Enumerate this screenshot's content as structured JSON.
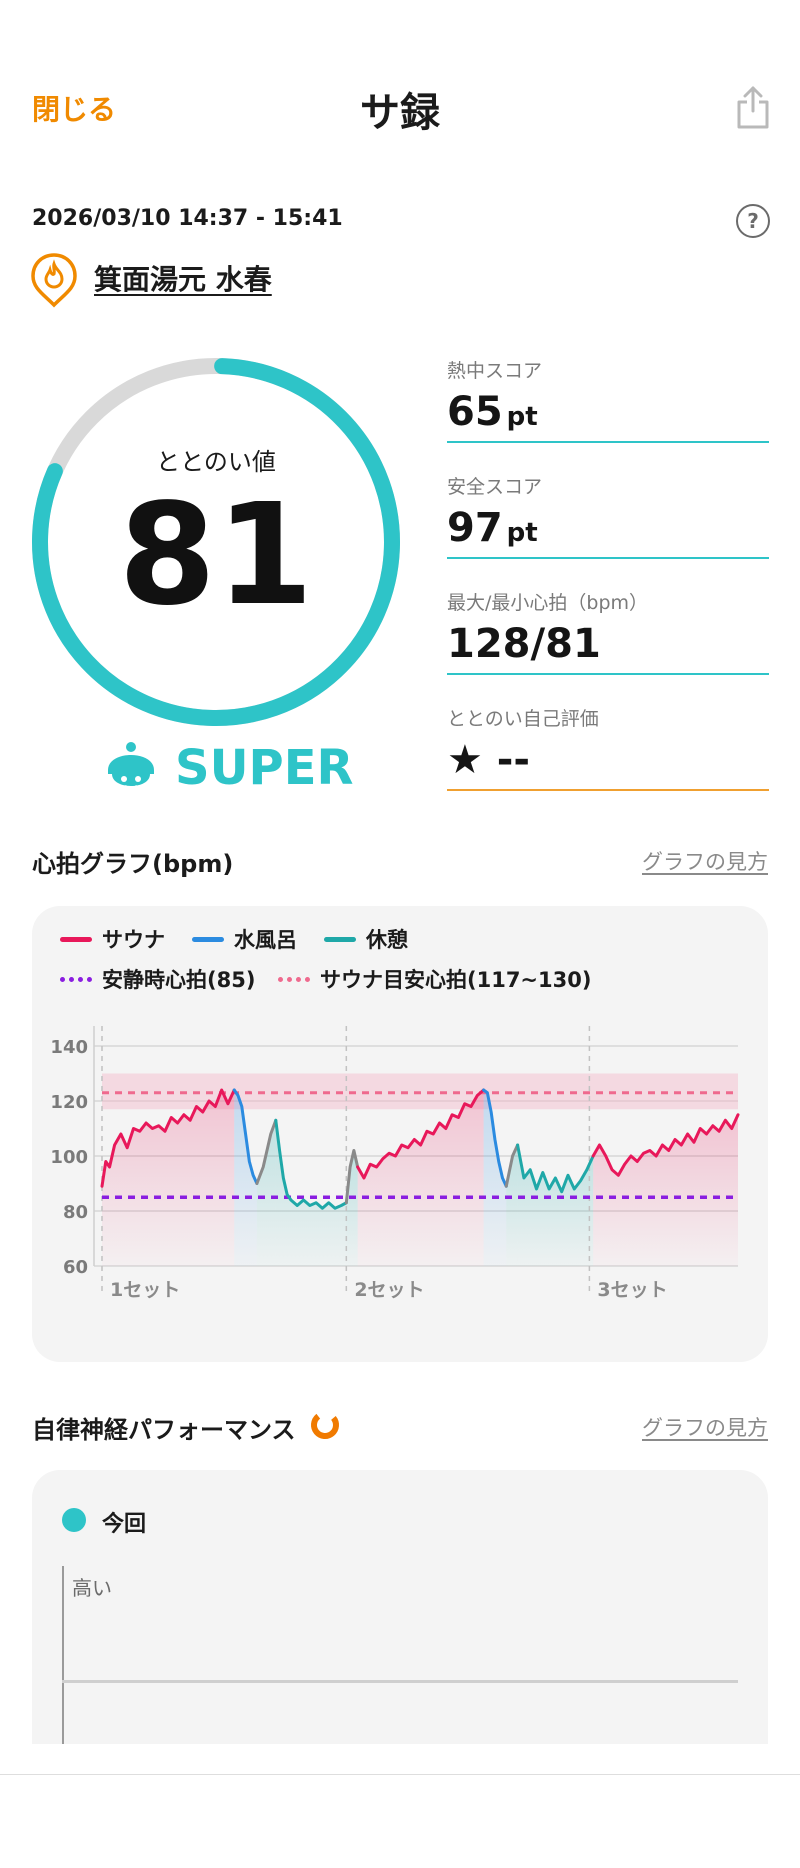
{
  "header": {
    "close_label": "閉じる",
    "title": "サ録"
  },
  "session": {
    "time_range": "2026/03/10 14:37 - 15:41",
    "place_name": "箕面湯元 水春"
  },
  "totonoi": {
    "label": "ととのい値",
    "value": "81",
    "progress": 0.81,
    "rank": "SUPER"
  },
  "stats": [
    {
      "label": "熱中スコア",
      "value": "65",
      "unit": "pt"
    },
    {
      "label": "安全スコア",
      "value": "97",
      "unit": "pt"
    },
    {
      "label": "最大/最小心拍（bpm）",
      "value": "128/81",
      "unit": ""
    },
    {
      "label": "ととのい自己評価",
      "value": "★ --",
      "unit": ""
    }
  ],
  "heart_graph": {
    "title": "心拍グラフ(bpm)",
    "link": "グラフの見方",
    "legend": {
      "sauna": "サウナ",
      "cold": "水風呂",
      "rest": "休憩",
      "resting_hr": "安静時心拍(85)",
      "sauna_target": "サウナ目安心拍(117~130)"
    }
  },
  "chart_data": {
    "type": "line",
    "ylim": [
      60,
      140
    ],
    "yticks": [
      "140",
      "120",
      "100",
      "80",
      "60"
    ],
    "set_labels": [
      "1セット",
      "2セット",
      "3セット"
    ],
    "reference_lines": {
      "resting": 85,
      "target_band": [
        117,
        130
      ],
      "target_line": 123
    },
    "colors": {
      "sauna": "#e8185a",
      "cold": "#2b8be0",
      "rest": "#1fa8a8",
      "transition": "#8a8a8a",
      "resting": "#8a1ee0",
      "target": "#ef6a8e"
    },
    "segments": [
      {
        "type": "sauna",
        "points": [
          [
            0,
            89
          ],
          [
            0.3,
            98
          ],
          [
            0.6,
            96
          ],
          [
            1,
            104
          ],
          [
            1.5,
            108
          ],
          [
            2,
            103
          ],
          [
            2.5,
            110
          ],
          [
            3,
            109
          ],
          [
            3.5,
            112
          ],
          [
            4,
            110
          ],
          [
            4.5,
            111
          ],
          [
            5,
            109
          ],
          [
            5.5,
            114
          ],
          [
            6,
            112
          ],
          [
            6.5,
            115
          ],
          [
            7,
            113
          ],
          [
            7.5,
            118
          ],
          [
            8,
            116
          ],
          [
            8.5,
            120
          ],
          [
            9,
            118
          ],
          [
            9.5,
            124
          ],
          [
            10,
            119
          ],
          [
            10.5,
            124
          ]
        ]
      },
      {
        "type": "cold",
        "points": [
          [
            10.5,
            124
          ],
          [
            10.8,
            122
          ],
          [
            11.1,
            118
          ],
          [
            11.4,
            108
          ],
          [
            11.7,
            98
          ],
          [
            12,
            93
          ],
          [
            12.3,
            90
          ]
        ]
      },
      {
        "type": "transition",
        "points": [
          [
            12.3,
            90
          ],
          [
            12.8,
            96
          ],
          [
            13.4,
            108
          ],
          [
            13.8,
            113
          ]
        ]
      },
      {
        "type": "rest",
        "points": [
          [
            13.8,
            113
          ],
          [
            14.1,
            102
          ],
          [
            14.4,
            92
          ],
          [
            14.7,
            86
          ],
          [
            15,
            84
          ],
          [
            15.5,
            82
          ],
          [
            16,
            84
          ],
          [
            16.5,
            82
          ],
          [
            17,
            83
          ],
          [
            17.5,
            81
          ],
          [
            18,
            83
          ],
          [
            18.5,
            81
          ],
          [
            19,
            82
          ],
          [
            19.4,
            83
          ]
        ]
      },
      {
        "type": "transition",
        "points": [
          [
            19.4,
            83
          ],
          [
            19.7,
            96
          ],
          [
            20,
            102
          ],
          [
            20.3,
            96
          ]
        ]
      },
      {
        "type": "sauna",
        "points": [
          [
            20.3,
            96
          ],
          [
            20.8,
            92
          ],
          [
            21.3,
            97
          ],
          [
            21.8,
            96
          ],
          [
            22.3,
            99
          ],
          [
            22.8,
            101
          ],
          [
            23.3,
            100
          ],
          [
            23.8,
            104
          ],
          [
            24.3,
            103
          ],
          [
            24.8,
            106
          ],
          [
            25.3,
            104
          ],
          [
            25.8,
            109
          ],
          [
            26.3,
            108
          ],
          [
            26.8,
            112
          ],
          [
            27.3,
            110
          ],
          [
            27.8,
            115
          ],
          [
            28.3,
            114
          ],
          [
            28.8,
            119
          ],
          [
            29.3,
            118
          ],
          [
            29.8,
            122
          ],
          [
            30.3,
            124
          ]
        ]
      },
      {
        "type": "cold",
        "points": [
          [
            30.3,
            124
          ],
          [
            30.6,
            123
          ],
          [
            30.9,
            116
          ],
          [
            31.2,
            106
          ],
          [
            31.5,
            98
          ],
          [
            31.8,
            92
          ],
          [
            32.1,
            89
          ]
        ]
      },
      {
        "type": "transition",
        "points": [
          [
            32.1,
            89
          ],
          [
            32.6,
            100
          ],
          [
            33,
            104
          ]
        ]
      },
      {
        "type": "rest",
        "points": [
          [
            33,
            104
          ],
          [
            33.5,
            92
          ],
          [
            34,
            95
          ],
          [
            34.5,
            88
          ],
          [
            35,
            94
          ],
          [
            35.5,
            88
          ],
          [
            36,
            92
          ],
          [
            36.5,
            87
          ],
          [
            37,
            93
          ],
          [
            37.5,
            88
          ],
          [
            38,
            91
          ],
          [
            38.5,
            95
          ],
          [
            39,
            100
          ]
        ]
      },
      {
        "type": "sauna",
        "points": [
          [
            39,
            100
          ],
          [
            39.5,
            104
          ],
          [
            40,
            100
          ],
          [
            40.5,
            95
          ],
          [
            41,
            93
          ],
          [
            41.5,
            97
          ],
          [
            42,
            100
          ],
          [
            42.5,
            98
          ],
          [
            43,
            101
          ],
          [
            43.5,
            102
          ],
          [
            44,
            100
          ],
          [
            44.5,
            104
          ],
          [
            45,
            102
          ],
          [
            45.5,
            106
          ],
          [
            46,
            104
          ],
          [
            46.5,
            108
          ],
          [
            47,
            105
          ],
          [
            47.5,
            110
          ],
          [
            48,
            108
          ],
          [
            48.5,
            111
          ],
          [
            49,
            109
          ],
          [
            49.5,
            113
          ],
          [
            50,
            110
          ],
          [
            50.5,
            115
          ]
        ]
      }
    ],
    "shaded": [
      {
        "type": "cold",
        "from": 10.5,
        "to": 12.3
      },
      {
        "type": "rest",
        "from": 13.8,
        "to": 19.4
      },
      {
        "type": "cold",
        "from": 30.3,
        "to": 32.1
      },
      {
        "type": "rest",
        "from": 33,
        "to": 39
      }
    ],
    "set_starts": [
      0,
      19.4,
      38.7
    ],
    "x_range": [
      0,
      50.5
    ]
  },
  "ans_section": {
    "title": "自律神経パフォーマンス",
    "link": "グラフの見方",
    "legend_label": "今回",
    "axis_high": "高い"
  }
}
